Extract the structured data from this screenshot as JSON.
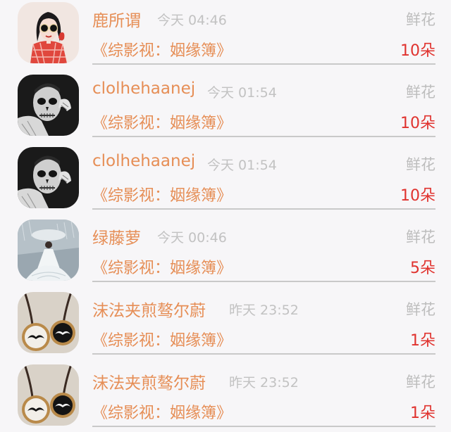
{
  "rows": [
    {
      "name": "鹿所谓",
      "time": "今天 04:46",
      "tag": "鲜花",
      "book": "《综影视：姻缘簿》",
      "count": "10朵",
      "avatar": "girl-with-sunglasses-avatar"
    },
    {
      "name": "clolhehaanej",
      "time": "今天 01:54",
      "tag": "鲜花",
      "book": "《综影视：姻缘簿》",
      "count": "10朵",
      "avatar": "skull-face-man-avatar"
    },
    {
      "name": "clolhehaanej",
      "time": "今天 01:54",
      "tag": "鲜花",
      "book": "《综影视：姻缘簿》",
      "count": "10朵",
      "avatar": "skull-face-man-avatar"
    },
    {
      "name": "绿藤萝",
      "time": "今天 00:46",
      "tag": "鲜花",
      "book": "《综影视：姻缘簿》",
      "count": "5朵",
      "avatar": "woman-in-white-gown-avatar"
    },
    {
      "name": "沫法夹煎骜尔蔚",
      "time": "昨天 23:52",
      "tag": "鲜花",
      "book": "《综影视：姻缘簿》",
      "count": "1朵",
      "avatar": "mustache-pendants-avatar"
    },
    {
      "name": "沫法夹煎骜尔蔚",
      "time": "昨天 23:52",
      "tag": "鲜花",
      "book": "《综影视：姻缘簿》",
      "count": "1朵",
      "avatar": "mustache-pendants-avatar"
    }
  ],
  "colors": {
    "name": "#e68e56",
    "time": "#c2c2c2",
    "tag": "#bdbdbd",
    "count": "#e0322e",
    "background": "#f7f6f8"
  }
}
